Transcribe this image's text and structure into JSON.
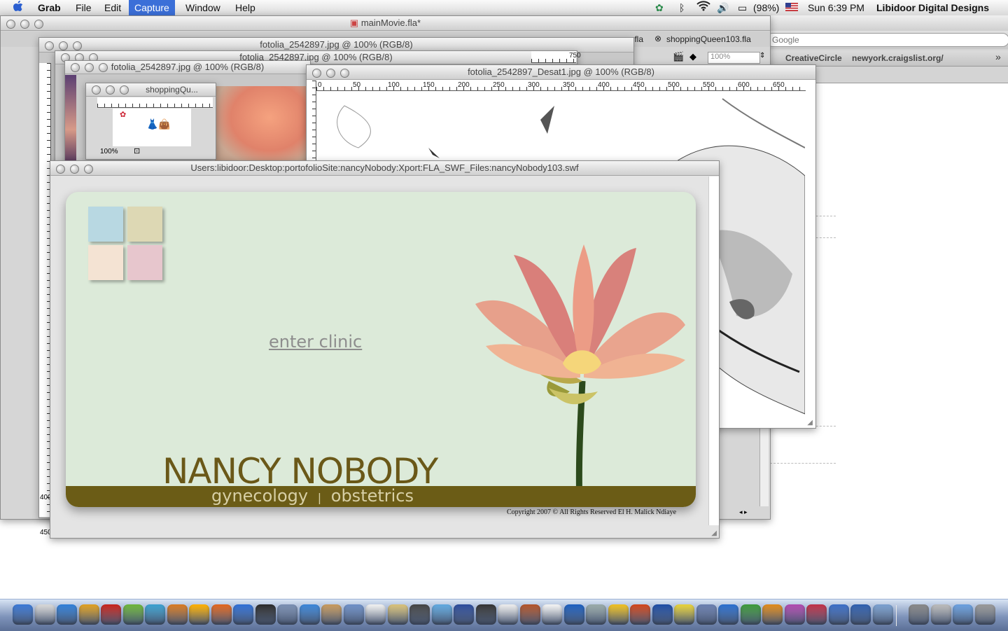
{
  "menubar": {
    "app": "Grab",
    "items": [
      "File",
      "Edit",
      "Capture",
      "Window",
      "Help"
    ],
    "battery": "(98%)",
    "clock": "Sun 6:39 PM",
    "user": "Libidoor Digital Designs"
  },
  "browser": {
    "search_placeholder": "Google",
    "bookmarks": [
      "CreativeCircle",
      "newyork.craigslist.org/"
    ],
    "tab_a": "shoppingQueen103.fla",
    "tab_b": ".fla",
    "zoom": "100%"
  },
  "windows": {
    "main_movie": "mainMovie.fla*",
    "fotolia_a": "fotolia_2542897.jpg @ 100% (RGB/8)",
    "fotolia_b": "fotolia_2542897.jpg @ 100% (RGB/8)",
    "fotolia_c": "fotolia_2542897.jpg @ 100% (RGB/8)",
    "shopping": "shoppingQu...",
    "shopping_zoom": "100%",
    "desat": "fotolia_2542897_Desat1.jpg @ 100% (RGB/8)",
    "swf_path": "Users:libidoor:Desktop:portofolioSite:nancyNobody:Xport:FLA_SWF_Files:nancyNobody103.swf"
  },
  "ruler": {
    "top": [
      "0",
      "50",
      "100",
      "150",
      "200",
      "250",
      "300",
      "350",
      "400",
      "450",
      "500",
      "550",
      "600",
      "650"
    ],
    "small": [
      "0",
      "50",
      "100",
      "150",
      "200",
      "250",
      "300"
    ],
    "mid": [
      "750"
    ],
    "side_left": [
      "400",
      "450"
    ]
  },
  "site": {
    "enter": "enter clinic",
    "name": "NANCY NOBODY",
    "specialty_a": "gynecology",
    "specialty_sep": "|",
    "specialty_b": "obstetrics",
    "copyright": "Copyright 2007 ©  All Rights Reserved  El H. Malick Ndiaye"
  },
  "colors": {
    "panel": "#dcead9",
    "band": "#6b5c16",
    "title": "#6a5818",
    "tile_blue": "#b8d8e2",
    "tile_tan": "#ddd8b4",
    "tile_peach": "#f4e3d3",
    "tile_pink": "#e7c6cd"
  },
  "dock_icons": [
    "finder-icon",
    "preview-icon",
    "safari-icon",
    "dreamweaver-icon",
    "flash-icon",
    "fireworks-icon",
    "illustrator-icon",
    "pencil-icon",
    "flower-icon",
    "firefox-icon",
    "ie-icon",
    "netscape-icon",
    "network-icon",
    "ichat-icon",
    "addressbook-icon",
    "mail-icon",
    "textedit-icon",
    "notes-icon",
    "photos-icon",
    "itunes-icon",
    "imovie-icon",
    "idvd-icon",
    "ipod-icon",
    "garageband-icon",
    "ical-icon",
    "quicktime-icon",
    "system-prefs-icon",
    "shield-icon",
    "director-icon",
    "globe-icon",
    "duck-icon",
    "package-icon",
    "w-icon",
    "leaf-icon",
    "p-icon",
    "q-icon",
    "snake-icon",
    "f-icon",
    "network2-icon",
    "preview2-icon",
    "utility-icon",
    "mail-alt-icon",
    "folder-icon",
    "trash-icon"
  ]
}
